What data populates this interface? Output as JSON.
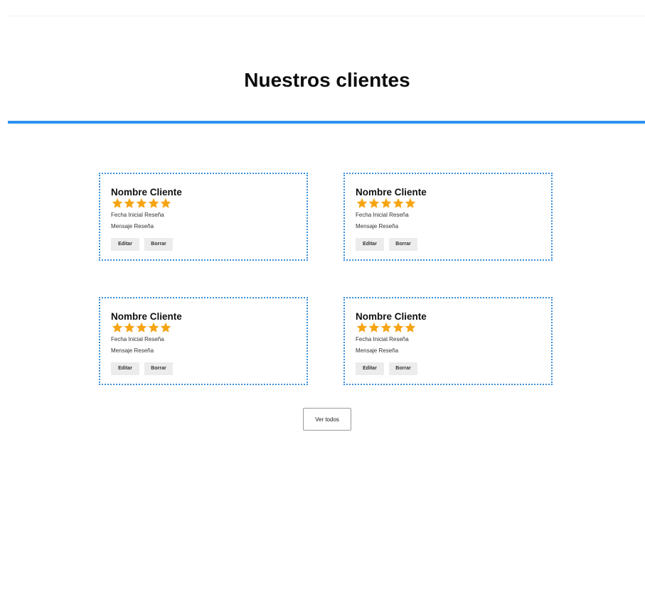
{
  "page_title": "Nuestros clientes",
  "colors": {
    "accent": "#2d93f0",
    "card_border": "#3a8ed8",
    "star": "#f5a412",
    "button_bg": "#ececec"
  },
  "reviews": [
    {
      "name": "Nombre Cliente",
      "rating": 5,
      "rating_max": 5,
      "date": "Fecha Inicial Reseña",
      "message": "Mensaje Reseña",
      "edit_label": "Editar",
      "delete_label": "Borrar"
    },
    {
      "name": "Nombre Cliente",
      "rating": 5,
      "rating_max": 5,
      "date": "Fecha Inicial Reseña",
      "message": "Mensaje Reseña",
      "edit_label": "Editar",
      "delete_label": "Borrar"
    },
    {
      "name": "Nombre Cliente",
      "rating": 5,
      "rating_max": 5,
      "date": "Fecha Inicial Reseña",
      "message": "Mensaje Reseña",
      "edit_label": "Editar",
      "delete_label": "Borrar"
    },
    {
      "name": "Nombre Cliente",
      "rating": 5,
      "rating_max": 5,
      "date": "Fecha Inicial Reseña",
      "message": "Mensaje Reseña",
      "edit_label": "Editar",
      "delete_label": "Borrar"
    }
  ],
  "see_all_label": "Ver todos"
}
